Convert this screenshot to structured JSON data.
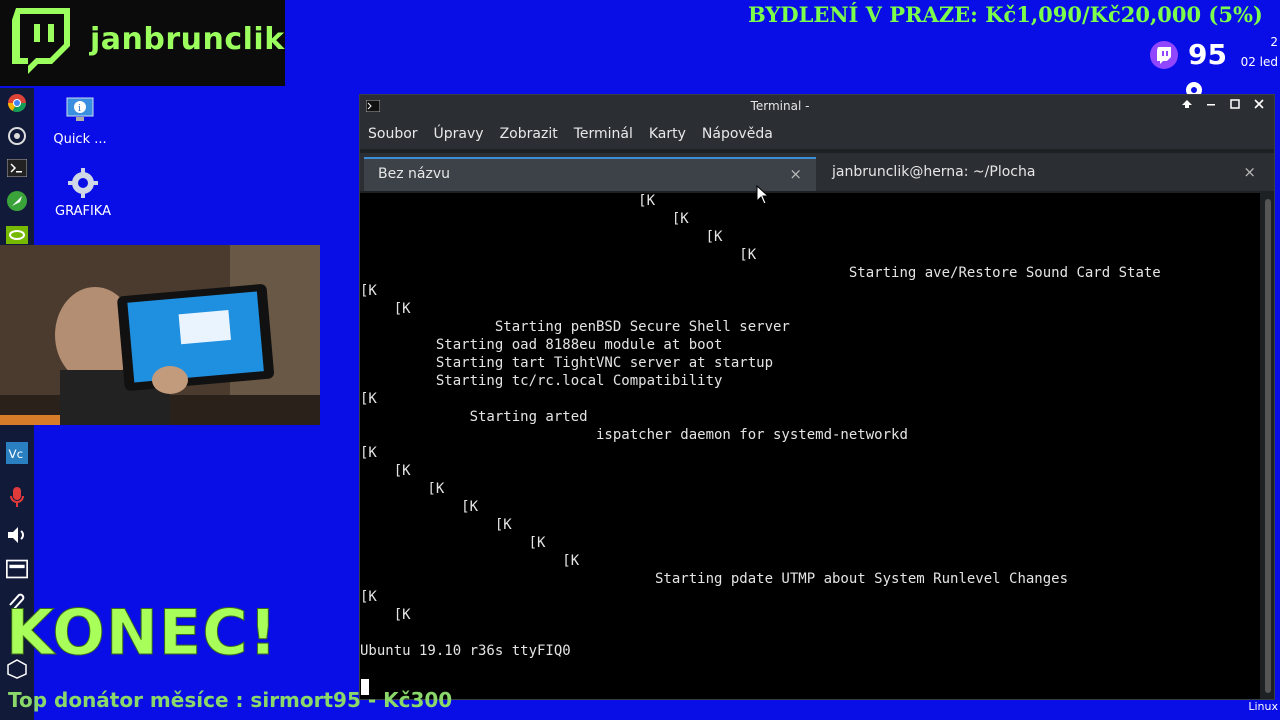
{
  "overlay": {
    "channel_name": "janbrunclik",
    "goal_banner": "BYDLENÍ V PRAZE: Kč1,090/Kč20,000 (5%)",
    "viewer_count": "95",
    "clock_top": "2",
    "clock_date": "02 led",
    "konec": "KONEC!",
    "donor": "Top donátor měsíce : sirmort95 - Kč300",
    "tray_text": "Linux"
  },
  "desktop": {
    "icons": [
      {
        "label": "Quick ...",
        "icon": "info-monitor-icon"
      },
      {
        "label": "GRAFIKA",
        "icon": "gear-icon"
      }
    ]
  },
  "dock": {
    "icons": [
      "chrome-icon",
      "settings-wheel-icon",
      "terminal-icon",
      "rocket-icon",
      "nvidia-icon",
      "vscode-icon",
      "microphone-icon",
      "speaker-icon",
      "network-icon",
      "paperclip-icon",
      "package-icon"
    ]
  },
  "terminal": {
    "window_title": "Terminal -",
    "menu": [
      "Soubor",
      "Úpravy",
      "Zobrazit",
      "Terminál",
      "Karty",
      "Nápověda"
    ],
    "tabs": [
      {
        "label": "Bez názvu",
        "active": true
      },
      {
        "label": "janbrunclik@herna: ~/Plocha",
        "active": false
      }
    ],
    "lines": [
      "                                 [K",
      "                                     [K",
      "                                         [K",
      "                                             [K",
      "                                                          Starting ave/Restore Sound Card State",
      "[K",
      "    [K",
      "                Starting penBSD Secure Shell server",
      "         Starting oad 8188eu module at boot",
      "         Starting tart TightVNC server at startup",
      "         Starting tc/rc.local Compatibility",
      "[K",
      "             Starting arted",
      "                            ispatcher daemon for systemd-networkd",
      "[K",
      "    [K",
      "        [K",
      "            [K",
      "                [K",
      "                    [K",
      "                        [K",
      "                                   Starting pdate UTMP about System Runlevel Changes",
      "[K",
      "    [K",
      "",
      "Ubuntu 19.10 r36s ttyFIQ0"
    ]
  }
}
